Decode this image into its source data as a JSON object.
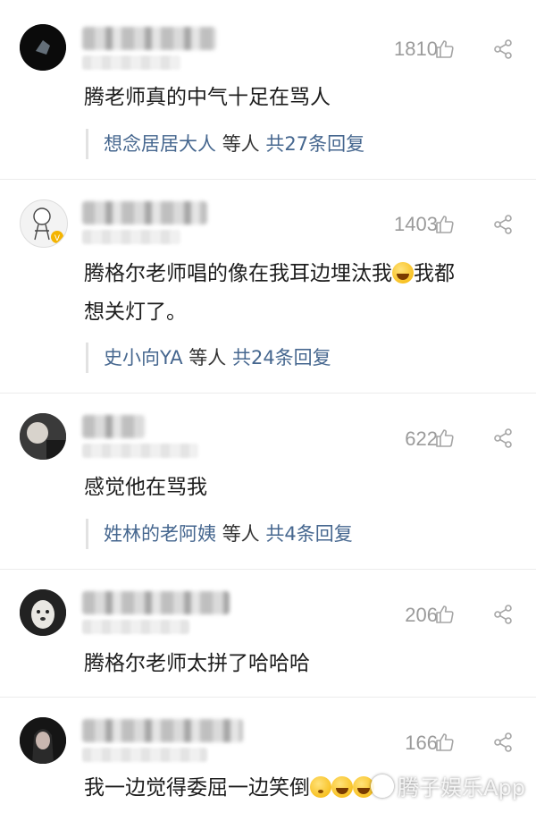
{
  "comments": [
    {
      "likes": "1810",
      "text": "腾老师真的中气十足在骂人",
      "reply": {
        "users": "想念居居大人",
        "mid": "等人",
        "count": "共27条回复"
      }
    },
    {
      "likes": "1403",
      "text1": "腾格尔老师唱的像在我耳边埋汰我",
      "text2": "我都",
      "text3": "想关灯了。",
      "reply": {
        "users": "史小向YA",
        "mid": "等人",
        "count": "共24条回复"
      }
    },
    {
      "likes": "622",
      "text": "感觉他在骂我",
      "reply": {
        "users": "姓林的老阿姨",
        "mid": "等人",
        "count": "共4条回复"
      }
    },
    {
      "likes": "206",
      "text": "腾格尔老师太拼了哈哈哈"
    },
    {
      "likes": "166",
      "text": "我一边觉得委屈一边笑倒"
    }
  ],
  "watermark": "腾子娱乐App",
  "colors": {
    "link": "#46678f",
    "meta": "#9b9b9b"
  },
  "icons": [
    "thumbs-up-icon",
    "share-icon",
    "crying-laughing-emoji",
    "pouting-emoji"
  ]
}
